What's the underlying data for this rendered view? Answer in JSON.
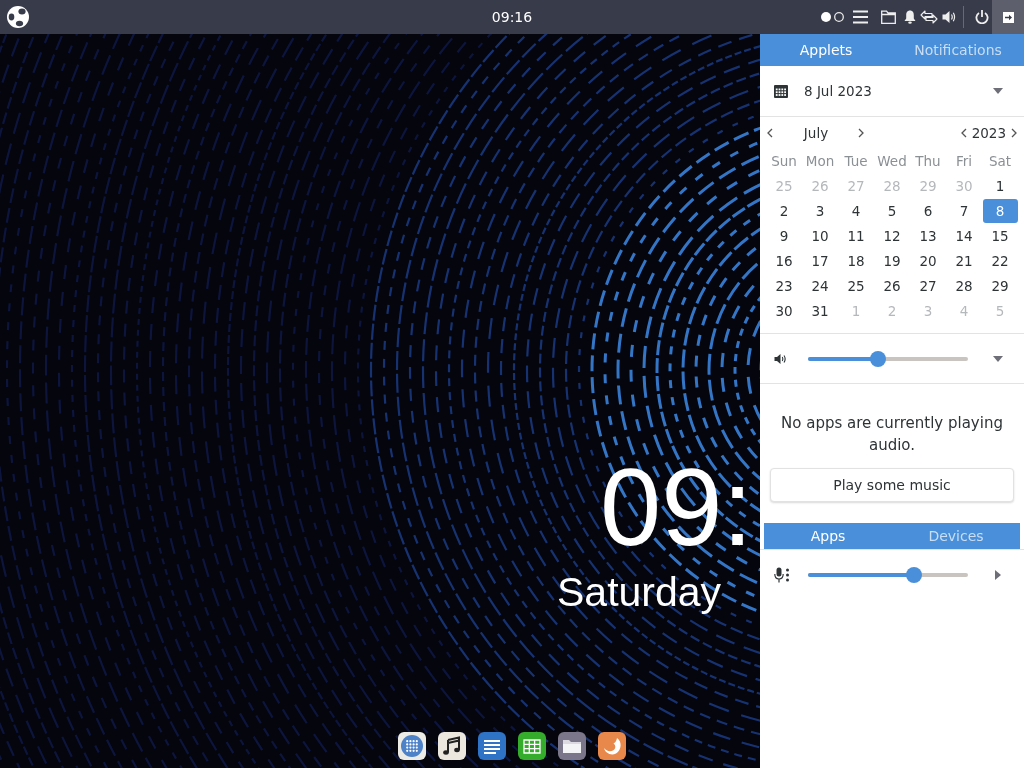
{
  "top_bar": {
    "clock": "09:16",
    "workspaces": [
      {
        "selected": true
      },
      {
        "selected": false
      }
    ],
    "panel_toggle": {
      "selected": true
    }
  },
  "desktop": {
    "clock": "09:",
    "day": "Saturday"
  },
  "panel": {
    "tabs": [
      {
        "label": "Applets",
        "selected": true
      },
      {
        "label": "Notifications",
        "selected": false
      }
    ],
    "date": "8 Jul 2023",
    "calendar": {
      "month": "July",
      "year": "2023",
      "weekdays": [
        "Sun",
        "Mon",
        "Tue",
        "Wed",
        "Thu",
        "Fri",
        "Sat"
      ],
      "weeks": [
        [
          {
            "day": "25",
            "other_month": true,
            "selected": false
          },
          {
            "day": "26",
            "other_month": true,
            "selected": false
          },
          {
            "day": "27",
            "other_month": true,
            "selected": false
          },
          {
            "day": "28",
            "other_month": true,
            "selected": false
          },
          {
            "day": "29",
            "other_month": true,
            "selected": false
          },
          {
            "day": "30",
            "other_month": true,
            "selected": false
          },
          {
            "day": "1",
            "other_month": false,
            "selected": false
          }
        ],
        [
          {
            "day": "2",
            "other_month": false,
            "selected": false
          },
          {
            "day": "3",
            "other_month": false,
            "selected": false
          },
          {
            "day": "4",
            "other_month": false,
            "selected": false
          },
          {
            "day": "5",
            "other_month": false,
            "selected": false
          },
          {
            "day": "6",
            "other_month": false,
            "selected": false
          },
          {
            "day": "7",
            "other_month": false,
            "selected": false
          },
          {
            "day": "8",
            "other_month": false,
            "selected": true
          }
        ],
        [
          {
            "day": "9",
            "other_month": false,
            "selected": false
          },
          {
            "day": "10",
            "other_month": false,
            "selected": false
          },
          {
            "day": "11",
            "other_month": false,
            "selected": false
          },
          {
            "day": "12",
            "other_month": false,
            "selected": false
          },
          {
            "day": "13",
            "other_month": false,
            "selected": false
          },
          {
            "day": "14",
            "other_month": false,
            "selected": false
          },
          {
            "day": "15",
            "other_month": false,
            "selected": false
          }
        ],
        [
          {
            "day": "16",
            "other_month": false,
            "selected": false
          },
          {
            "day": "17",
            "other_month": false,
            "selected": false
          },
          {
            "day": "18",
            "other_month": false,
            "selected": false
          },
          {
            "day": "19",
            "other_month": false,
            "selected": false
          },
          {
            "day": "20",
            "other_month": false,
            "selected": false
          },
          {
            "day": "21",
            "other_month": false,
            "selected": false
          },
          {
            "day": "22",
            "other_month": false,
            "selected": false
          }
        ],
        [
          {
            "day": "23",
            "other_month": false,
            "selected": false
          },
          {
            "day": "24",
            "other_month": false,
            "selected": false
          },
          {
            "day": "25",
            "other_month": false,
            "selected": false
          },
          {
            "day": "26",
            "other_month": false,
            "selected": false
          },
          {
            "day": "27",
            "other_month": false,
            "selected": false
          },
          {
            "day": "28",
            "other_month": false,
            "selected": false
          },
          {
            "day": "29",
            "other_month": false,
            "selected": false
          }
        ],
        [
          {
            "day": "30",
            "other_month": false,
            "selected": false
          },
          {
            "day": "31",
            "other_month": false,
            "selected": false
          },
          {
            "day": "1",
            "other_month": true,
            "selected": false
          },
          {
            "day": "2",
            "other_month": true,
            "selected": false
          },
          {
            "day": "3",
            "other_month": true,
            "selected": false
          },
          {
            "day": "4",
            "other_month": true,
            "selected": false
          },
          {
            "day": "5",
            "other_month": true,
            "selected": false
          }
        ]
      ]
    },
    "volume": {
      "level": 0.44
    },
    "media": {
      "message": "No apps are currently playing audio.",
      "button": "Play some music"
    },
    "mixer_tabs": [
      {
        "label": "Apps",
        "selected": true
      },
      {
        "label": "Devices",
        "selected": false
      }
    ],
    "input": {
      "level": 0.66
    }
  }
}
